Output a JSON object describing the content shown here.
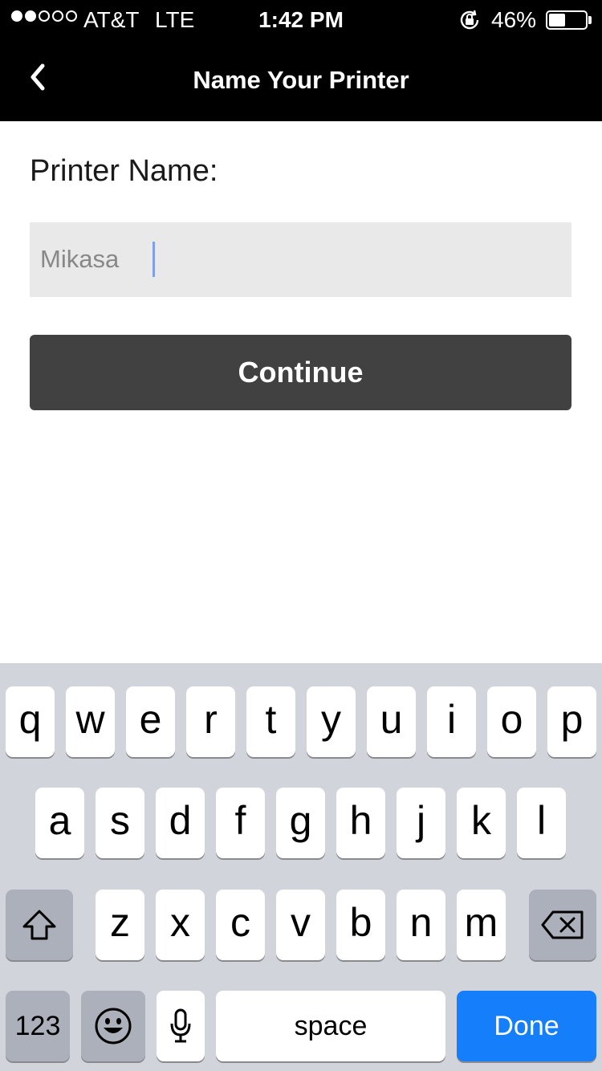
{
  "status_bar": {
    "signal_dots_filled": 2,
    "signal_dots_total": 5,
    "carrier": "AT&T",
    "network": "LTE",
    "time": "1:42 PM",
    "orientation_lock_icon": "rotation-lock-icon",
    "battery_percent": "46%",
    "battery_level": 0.46
  },
  "nav": {
    "back_icon": "chevron-left-icon",
    "title": "Name Your Printer"
  },
  "form": {
    "label": "Printer Name:",
    "printer_name_value": "Mikasa",
    "continue_label": "Continue"
  },
  "keyboard": {
    "row1": [
      "q",
      "w",
      "e",
      "r",
      "t",
      "y",
      "u",
      "i",
      "o",
      "p"
    ],
    "row2": [
      "a",
      "s",
      "d",
      "f",
      "g",
      "h",
      "j",
      "k",
      "l"
    ],
    "row3": [
      "z",
      "x",
      "c",
      "v",
      "b",
      "n",
      "m"
    ],
    "shift_icon": "shift-icon",
    "delete_icon": "backspace-icon",
    "numbers_label": "123",
    "emoji_icon": "emoji-icon",
    "mic_icon": "microphone-icon",
    "space_label": "space",
    "done_label": "Done"
  },
  "colors": {
    "topbar": "#000000",
    "button": "#414141",
    "field": "#e9e9e9",
    "keyboard_bg": "#d1d5db",
    "done_key": "#147efb"
  }
}
